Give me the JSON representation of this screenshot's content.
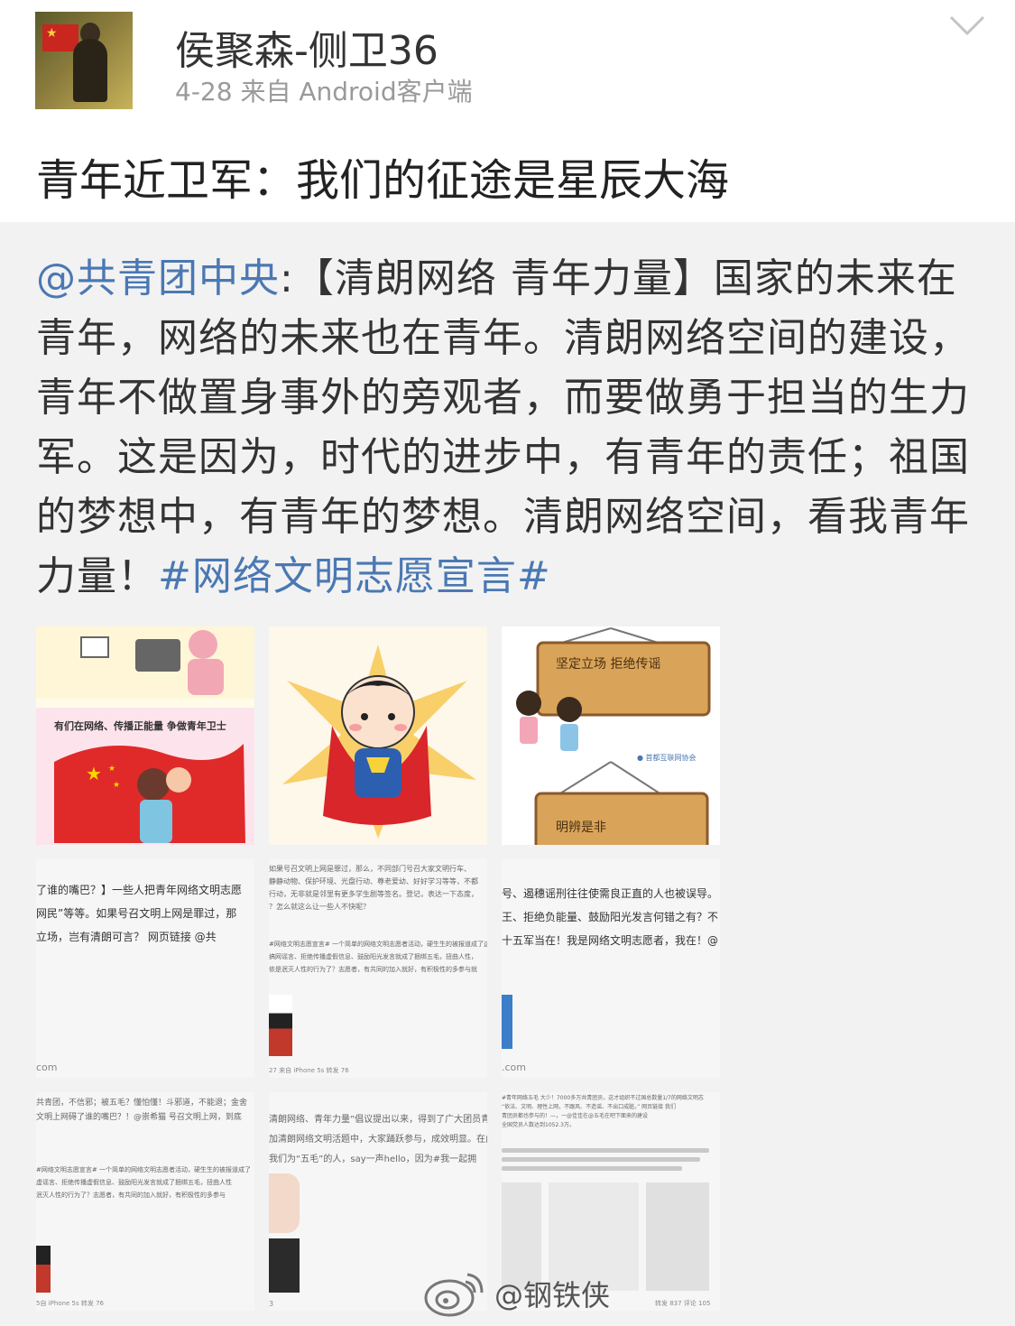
{
  "post": {
    "username": "侯聚森-侧卫36",
    "meta": "4-28  来自 Android客户端",
    "title": "青年近卫军：我们的征途是星辰大海"
  },
  "repost": {
    "mention": "@共青团中央",
    "colon": ":",
    "body": "【清朗网络 青年力量】国家的未来在青年，网络的未来也在青年。清朗网络空间的建设，青年不做置身事外的旁观者，而要做勇于担当的生力军。这是因为，时代的进步中，有青年的责任；祖国的梦想中，有青年的梦想。清朗网络空间，看我青年力量！",
    "hashtag": "#网络文明志愿宣言#"
  },
  "images": {
    "img1_caption": "有们在网络、传播正能量 争做青年卫士",
    "img3_sign1": "坚定立场 拒绝传谣",
    "img3_sign2": "明辨是非",
    "img4_lines": [
      "了谁的嘴巴？】一些人把青年网络文明志愿",
      "网民”等等。如果号召文明上网是罪过，那",
      "立场，岂有清朗可言？  网页链接  @共"
    ],
    "img4_footer": "com",
    "img5_lines": [
      "如果号召文明上网是罪过，那么，不同部门号召大家文明行车、",
      "静静动物、保护环境、光盘行动、尊老爱幼、好好学习等等，不都",
      "行动，无非就是邻里有更多学生剧等签名。登记，表达一下态度，",
      "？怎么就这么让一些人不快呢？"
    ],
    "img5_lines2": [
      "#网络文明志愿宣言# 一个简单的网络文明志愿者活动，硬生生的被报道成了这",
      "搞网谣言、拒绝传播虚假信息、鼓励阳光发言就成了捆绑五毛，扭曲人性，",
      "依是泯灭人性的行为了？志愿者，有共同的加入就好，有积极性的多参与就"
    ],
    "img5_footer": "27 来自 iPhone 5s        转发 76",
    "img6_lines": [
      "号、遏穗谣刑往往使需良正直的人也被误导。",
      "王、拒绝负能量、鼓励阳光发言何错之有？不",
      "十五军当在！我是网络文明志愿者，我在！@"
    ],
    "img6_footer": ".com",
    "img7_lines": [
      "共青团，不信邪；被五毛？懂怕懂！斗邪道，不能退；金舍",
      "文明上网碍了谁的嘴巴？！@崇希猫 号召文明上网，到底"
    ],
    "img7_lines2": [
      "#网络文明志愿宣言# 一个简单的网络文明志愿者活动，硬生生的被报道成了",
      "虚谣言、拒绝传播虚假信息、鼓励阳光发言就成了捆绑五毛，扭曲人性",
      "泯灭人性的行为了？志愿者，有共同的加入就好，有积极性的多参与"
    ],
    "img7_footer": "5自 iPhone 5s        转发 76",
    "img8_lines": [
      "清朗网络、青年力量”倡议提出以来，得到了广大团员青年",
      "加清朗网络文明活题中，大家踊跃参与，成效明显。在此向",
      "我们为“五毛”的人，say一声hello，因为#我一起拥"
    ],
    "img8_footer": "3",
    "img9_lines": [
      "#青年网络五毛 大少！7000多万共青团员，这才组织不过国总数量1/7的网络文明志",
      "“依法、文明、理性上网，不跟风、不造谣、不出口成脏。” 网页链接 我们",
      "青团员都也参与的！—，一@佳佳在@五毛在吧下面来的建设",
      "全国党员人数达到1052.3万。"
    ],
    "img9_footer": "转发 837   评论 105",
    "watermark": "@钢铁侠"
  },
  "colors": {
    "link": "#4a78b3",
    "text": "#333333",
    "meta": "#9a9a9a",
    "background": "#f2f2f2"
  }
}
